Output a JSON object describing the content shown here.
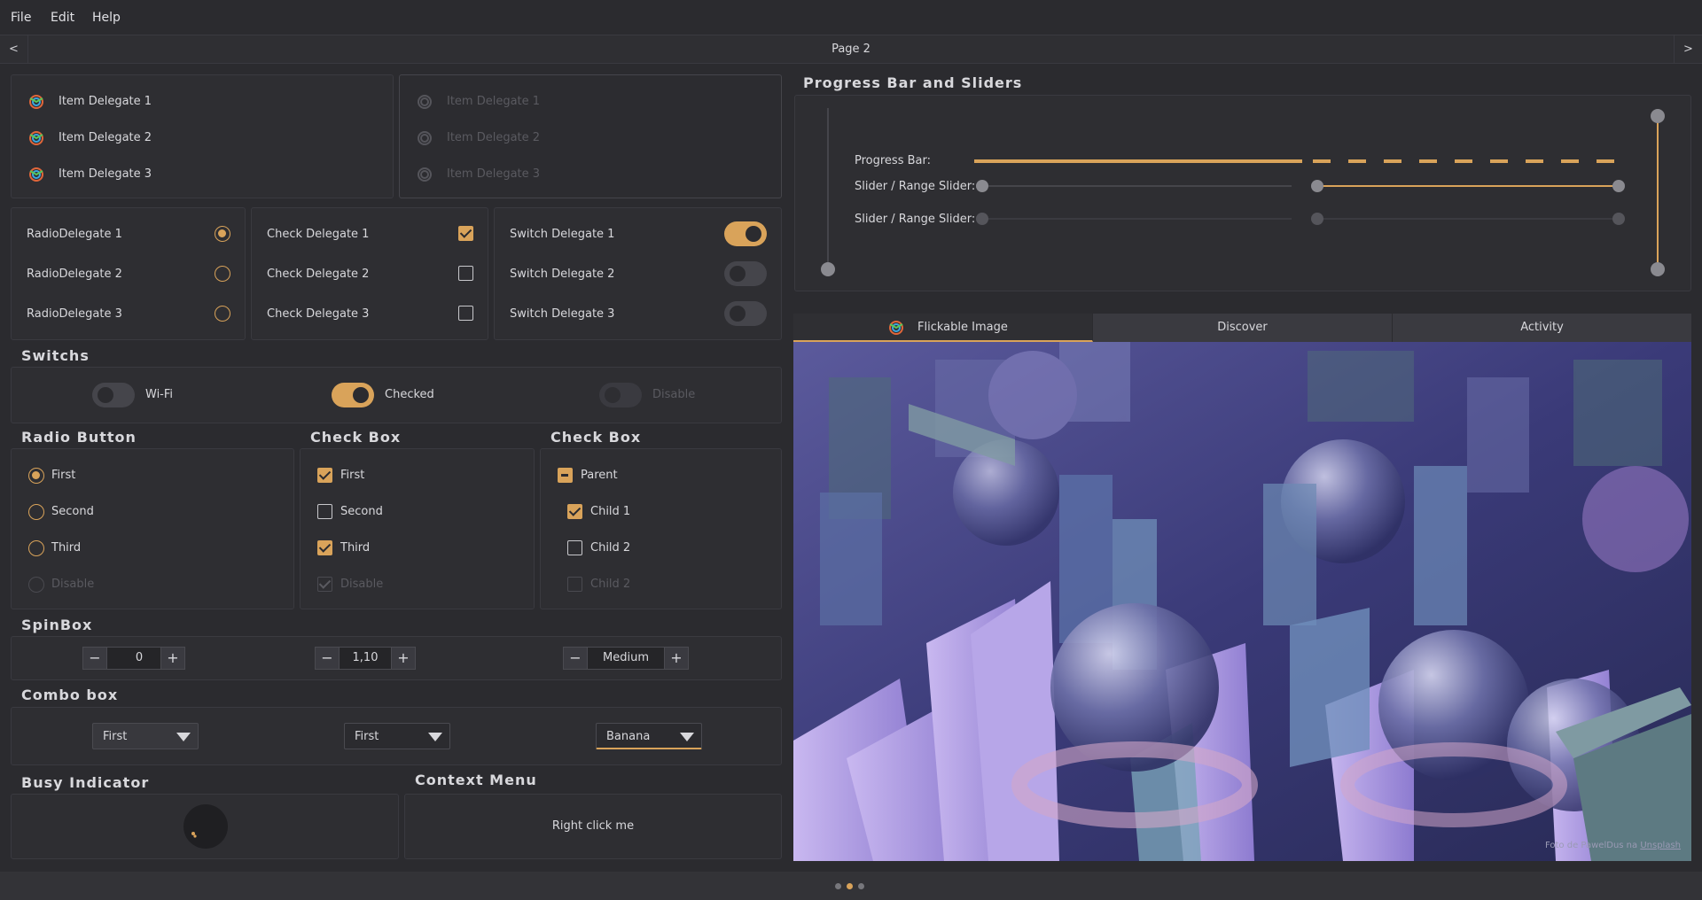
{
  "menu": {
    "file": "File",
    "edit": "Edit",
    "help": "Help"
  },
  "header": {
    "prev": "<",
    "title": "Page 2",
    "next": ">"
  },
  "item_delegates": {
    "enabled": [
      "Item Delegate 1",
      "Item Delegate 2",
      "Item Delegate 3"
    ],
    "disabled": [
      "Item Delegate 1",
      "Item Delegate 2",
      "Item Delegate 3"
    ]
  },
  "radio_delegates": [
    {
      "label": "RadioDelegate 1",
      "checked": true
    },
    {
      "label": "RadioDelegate 2",
      "checked": false
    },
    {
      "label": "RadioDelegate 3",
      "checked": false
    }
  ],
  "check_delegates": [
    {
      "label": "Check Delegate 1",
      "checked": true
    },
    {
      "label": "Check Delegate 2",
      "checked": false
    },
    {
      "label": "Check Delegate 3",
      "checked": false
    }
  ],
  "switch_delegates": [
    {
      "label": "Switch Delegate 1",
      "on": true
    },
    {
      "label": "Switch Delegate 2",
      "on": false
    },
    {
      "label": "Switch Delegate 3",
      "on": false
    }
  ],
  "switchs": {
    "title": "Switchs",
    "items": [
      {
        "label": "Wi-Fi",
        "on": false,
        "disabled": false
      },
      {
        "label": "Checked",
        "on": true,
        "disabled": false
      },
      {
        "label": "Disable",
        "on": false,
        "disabled": true
      }
    ]
  },
  "radio_button": {
    "title": "Radio Button",
    "items": [
      {
        "label": "First",
        "checked": true,
        "disabled": false
      },
      {
        "label": "Second",
        "checked": false,
        "disabled": false
      },
      {
        "label": "Third",
        "checked": false,
        "disabled": false
      },
      {
        "label": "Disable",
        "checked": false,
        "disabled": true
      }
    ]
  },
  "check_box": {
    "title": "Check Box",
    "items": [
      {
        "label": "First",
        "checked": true,
        "disabled": false
      },
      {
        "label": "Second",
        "checked": false,
        "disabled": false
      },
      {
        "label": "Third",
        "checked": true,
        "disabled": false
      },
      {
        "label": "Disable",
        "checked": true,
        "disabled": true
      }
    ]
  },
  "check_box_tree": {
    "title": "Check Box",
    "items": [
      {
        "label": "Parent",
        "state": "partial",
        "disabled": false
      },
      {
        "label": "Child 1",
        "state": "checked",
        "disabled": false
      },
      {
        "label": "Child 2",
        "state": "unchecked",
        "disabled": false
      },
      {
        "label": "Child 2",
        "state": "unchecked",
        "disabled": true
      }
    ]
  },
  "spinbox": {
    "title": "SpinBox",
    "minus": "−",
    "plus": "+",
    "values": [
      "0",
      "1,10",
      "Medium"
    ]
  },
  "combo_box": {
    "title": "Combo box",
    "values": [
      "First",
      "First",
      "Banana"
    ]
  },
  "busy": {
    "title": "Busy Indicator"
  },
  "context_menu": {
    "title": "Context Menu",
    "text": "Right click me"
  },
  "progress": {
    "title": "Progress Bar and Sliders",
    "progress_label": "Progress Bar:",
    "progress_value": 0.5,
    "slider_label_1": "Slider / Range Slider:",
    "slider_label_2": "Slider / Range Slider:",
    "slider1_value": 0.0,
    "range1": [
      0.0,
      1.0
    ],
    "vertical_slider_value": 0.0,
    "vertical_range": [
      0.0,
      1.0
    ]
  },
  "tabs": [
    {
      "label": "Flickable Image"
    },
    {
      "label": "Discover"
    },
    {
      "label": "Activity"
    }
  ],
  "image": {
    "credit_prefix": "Foto de ",
    "credit_author": "PawelDus",
    "credit_mid": " na ",
    "credit_site": "Unsplash"
  },
  "pager": {
    "count": 3,
    "current": 2
  },
  "colors": {
    "accent": "#d9a35a",
    "background": "#2b2b2f"
  }
}
